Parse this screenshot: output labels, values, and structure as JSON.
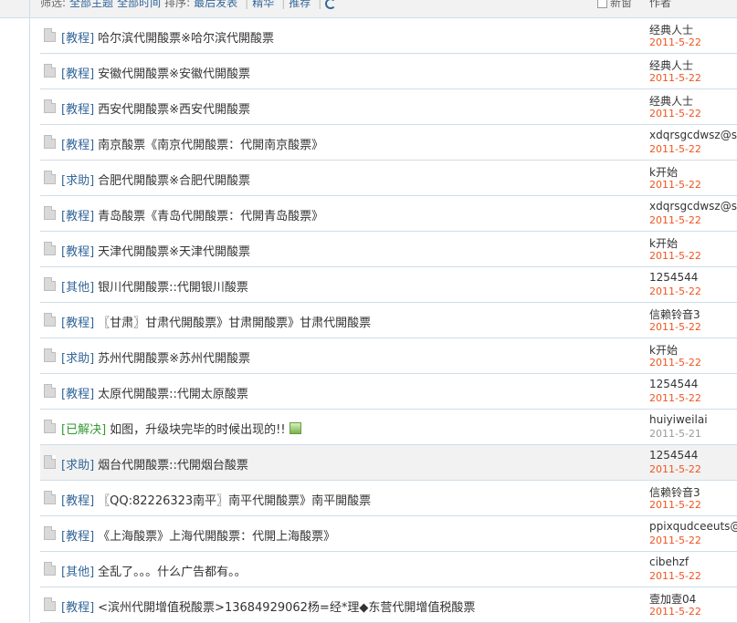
{
  "header": {
    "filter_label": "筛选:",
    "filter_topics": "全部主题",
    "filter_time": "全部时间",
    "sort_label": "排序:",
    "sort_value": "最后发表",
    "link_digest": "精华",
    "link_recommend": "推荐",
    "new_label": "新窗",
    "author_col": "作者"
  },
  "threads": [
    {
      "category": "[教程]",
      "subject": "哈尔滨代開酸票※哈尔滨代開酸票",
      "author": "经典人士",
      "date": "2011-5-22",
      "date_style": "new",
      "has_image": false
    },
    {
      "category": "[教程]",
      "subject": "安徽代開酸票※安徽代開酸票",
      "author": "经典人士",
      "date": "2011-5-22",
      "date_style": "new",
      "has_image": false
    },
    {
      "category": "[教程]",
      "subject": "西安代開酸票※西安代開酸票",
      "author": "经典人士",
      "date": "2011-5-22",
      "date_style": "new",
      "has_image": false
    },
    {
      "category": "[教程]",
      "subject": "南京酸票《南京代開酸票：代開南京酸票》",
      "author": "xdqrsgcdwsz@sin",
      "date": "2011-5-22",
      "date_style": "new",
      "has_image": false
    },
    {
      "category": "[求助]",
      "subject": "合肥代開酸票※合肥代開酸票",
      "author": "k开始",
      "date": "2011-5-22",
      "date_style": "new",
      "has_image": false
    },
    {
      "category": "[教程]",
      "subject": "青岛酸票《青岛代開酸票：代開青岛酸票》",
      "author": "xdqrsgcdwsz@sin",
      "date": "2011-5-22",
      "date_style": "new",
      "has_image": false
    },
    {
      "category": "[教程]",
      "subject": "天津代開酸票※天津代開酸票",
      "author": "k开始",
      "date": "2011-5-22",
      "date_style": "new",
      "has_image": false
    },
    {
      "category": "[其他]",
      "subject": "银川代開酸票::代開银川酸票",
      "author": "1254544",
      "date": "2011-5-22",
      "date_style": "new",
      "has_image": false
    },
    {
      "category": "[教程]",
      "subject": "〖甘肃〗甘肃代開酸票》甘肃開酸票》甘肃代開酸票",
      "author": "信赖铃音3",
      "date": "2011-5-22",
      "date_style": "new",
      "has_image": false
    },
    {
      "category": "[求助]",
      "subject": "苏州代開酸票※苏州代開酸票",
      "author": "k开始",
      "date": "2011-5-22",
      "date_style": "new",
      "has_image": false
    },
    {
      "category": "[教程]",
      "subject": "太原代開酸票::代開太原酸票",
      "author": "1254544",
      "date": "2011-5-22",
      "date_style": "new",
      "has_image": false
    },
    {
      "category": "[已解决]",
      "subject": "如图，升级块完毕的时候出现的!!",
      "author": "huiyiweilai",
      "date": "2011-5-21",
      "date_style": "old",
      "has_image": true
    },
    {
      "category": "[求助]",
      "subject": "烟台代開酸票::代開烟台酸票",
      "author": "1254544",
      "date": "2011-5-22",
      "date_style": "new",
      "has_image": false
    },
    {
      "category": "[教程]",
      "subject": "〖QQ:82226323南平〗南平代開酸票》南平開酸票",
      "author": "信赖铃音3",
      "date": "2011-5-22",
      "date_style": "new",
      "has_image": false
    },
    {
      "category": "[教程]",
      "subject": "《上海酸票》上海代開酸票：代開上海酸票》",
      "author": "ppixqudceeuts@s",
      "date": "2011-5-22",
      "date_style": "new",
      "has_image": false
    },
    {
      "category": "[其他]",
      "subject": "全乱了。。。什么广告都有。。",
      "author": "cibehzf",
      "date": "2011-5-22",
      "date_style": "new",
      "has_image": false
    },
    {
      "category": "[教程]",
      "subject": "<滨州代開增值税酸票>13684929062杨=经*理◆东营代開增值税酸票",
      "author": "壹加壹04",
      "date": "2011-5-22",
      "date_style": "new",
      "has_image": false
    }
  ],
  "hover_row_index": 12
}
